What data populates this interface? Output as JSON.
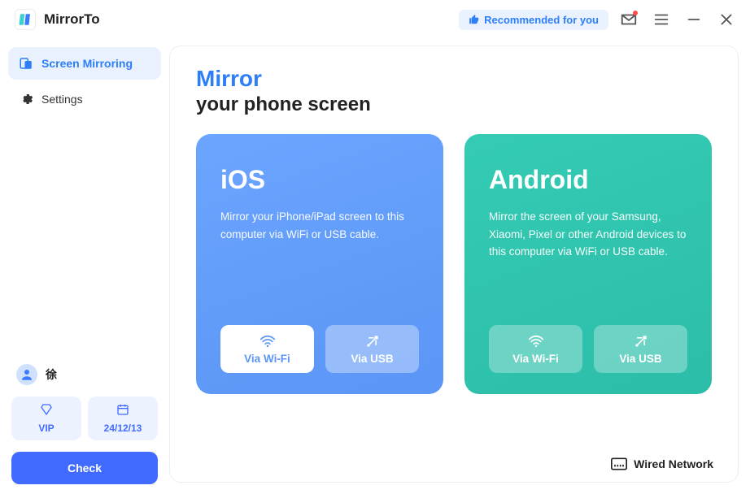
{
  "app": {
    "title": "MirrorTo"
  },
  "titlebar": {
    "recommended_label": "Recommended for you"
  },
  "sidebar": {
    "items": [
      {
        "label": "Screen Mirroring"
      },
      {
        "label": "Settings"
      }
    ]
  },
  "user": {
    "name": "徐"
  },
  "status": {
    "vip_label": "VIP",
    "expiry": "24/12/13",
    "check_label": "Check"
  },
  "main": {
    "heading1": "Mirror",
    "heading2": "your phone screen",
    "ios": {
      "title": "iOS",
      "desc": "Mirror your iPhone/iPad screen to this computer via WiFi or USB cable.",
      "wifi_label": "Via Wi-Fi",
      "usb_label": "Via USB"
    },
    "android": {
      "title": "Android",
      "desc": "Mirror the screen of your Samsung, Xiaomi, Pixel or other Android devices to this computer via WiFi or USB cable.",
      "wifi_label": "Via Wi-Fi",
      "usb_label": "Via USB"
    },
    "network_label": "Wired Network"
  }
}
